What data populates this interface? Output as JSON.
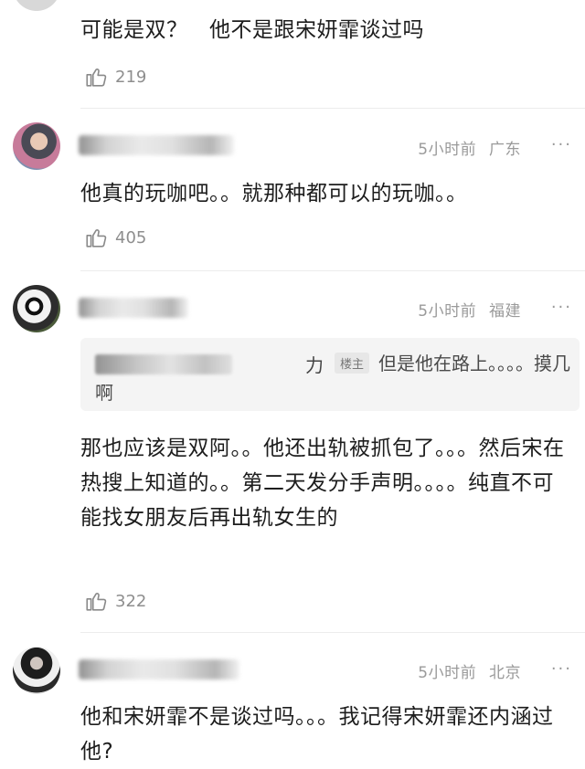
{
  "comments": [
    {
      "text": "可能是双？　他不是跟宋妍霏谈过吗",
      "likes": "219"
    },
    {
      "username_hint": "4",
      "time": "5小时前",
      "location": "广东",
      "text": "他真的玩咖吧。。就那种都可以的玩咖。。",
      "likes": "405"
    },
    {
      "time": "5小时前",
      "location": "福建",
      "quote": {
        "name_char": "力",
        "badge": "楼主",
        "text": "但是他在路上。。。。摸几啊"
      },
      "text": "那也应该是双阿。。他还出轨被抓包了。。。然后宋在热搜上知道的。。第二天发分手声明。。。。纯直不可能找女朋友后再出轨女生的",
      "likes": "322"
    },
    {
      "time": "5小时前",
      "location": "北京",
      "text": "他和宋妍霏不是谈过吗。。。我记得宋妍霏还内涵过他?"
    }
  ],
  "more_glyph": "···",
  "icons": {
    "like": "thumbs-up-icon",
    "more": "more-dots-icon"
  },
  "colors": {
    "meta": "#9a9a9a",
    "text": "#1d1d1d",
    "divider": "#ececec",
    "quote_bg": "#f4f4f4"
  }
}
